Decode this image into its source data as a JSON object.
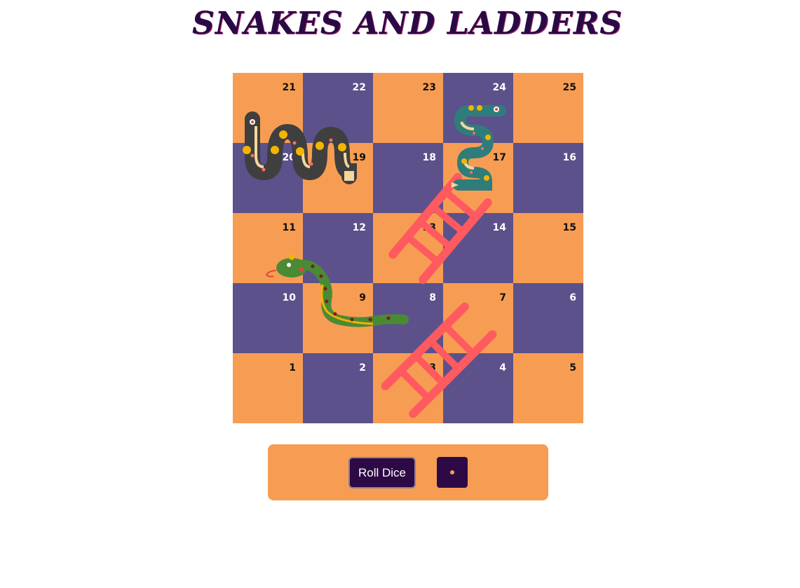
{
  "title": "SNAKES AND LADDERS",
  "colors": {
    "orange": "#f79d53",
    "purple": "#5c518b",
    "dark": "#2d0a46",
    "ladder": "#ff5a5f"
  },
  "board": {
    "rows": [
      [
        {
          "num": "21",
          "color": "orange"
        },
        {
          "num": "22",
          "color": "purple"
        },
        {
          "num": "23",
          "color": "orange"
        },
        {
          "num": "24",
          "color": "purple"
        },
        {
          "num": "25",
          "color": "orange"
        }
      ],
      [
        {
          "num": "20",
          "color": "purple"
        },
        {
          "num": "19",
          "color": "orange"
        },
        {
          "num": "18",
          "color": "purple"
        },
        {
          "num": "17",
          "color": "orange"
        },
        {
          "num": "16",
          "color": "purple"
        }
      ],
      [
        {
          "num": "11",
          "color": "orange"
        },
        {
          "num": "12",
          "color": "purple"
        },
        {
          "num": "13",
          "color": "orange"
        },
        {
          "num": "14",
          "color": "purple"
        },
        {
          "num": "15",
          "color": "orange"
        }
      ],
      [
        {
          "num": "10",
          "color": "purple"
        },
        {
          "num": "9",
          "color": "orange"
        },
        {
          "num": "8",
          "color": "purple"
        },
        {
          "num": "7",
          "color": "orange"
        },
        {
          "num": "6",
          "color": "purple"
        }
      ],
      [
        {
          "num": "1",
          "color": "orange"
        },
        {
          "num": "2",
          "color": "purple"
        },
        {
          "num": "3",
          "color": "orange"
        },
        {
          "num": "4",
          "color": "purple"
        },
        {
          "num": "5",
          "color": "orange"
        }
      ]
    ]
  },
  "controls": {
    "roll_label": "Roll Dice",
    "dice_value": 1
  },
  "icons": {
    "snake_dark": "snake-dark-icon",
    "snake_teal": "snake-teal-icon",
    "snake_green": "snake-green-icon",
    "ladder": "ladder-icon",
    "dice": "dice-icon"
  }
}
